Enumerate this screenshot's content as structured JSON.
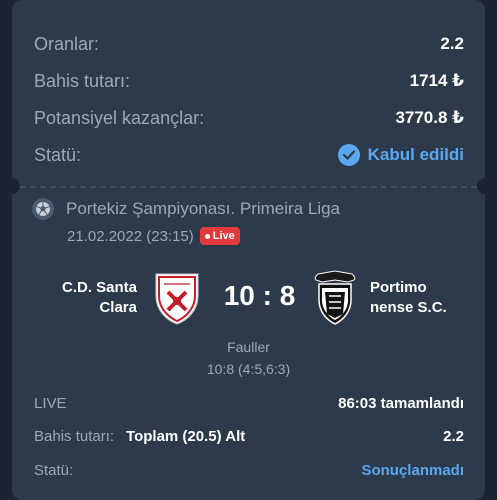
{
  "summary": {
    "odds_label": "Oranlar:",
    "odds_value": "2.2",
    "stake_label": "Bahis tutarı:",
    "stake_value": "1714 ₺",
    "potential_label": "Potansiyel kazançlar:",
    "potential_value": "3770.8 ₺",
    "status_label": "Statü:",
    "status_value": "Kabul edildi"
  },
  "match": {
    "league": "Portekiz Şampiyonası. Primeira Liga",
    "datetime": "21.02.2022 (23:15)",
    "live_badge": "Live",
    "home_team": "C.D. Santa Clara",
    "away_team": "Portimo nense S.C.",
    "score": "10 : 8",
    "fouls_label": "Fauller",
    "fouls_value": "10:8 (4:5,6:3)"
  },
  "bet": {
    "state_label": "LIVE",
    "state_value": "86:03 tamamlandı",
    "stake_label": "Bahis tutarı:",
    "selection": "Toplam (20.5) Alt",
    "odds": "2.2",
    "status_label": "Statü:",
    "status_value": "Sonuçlanmadı"
  },
  "colors": {
    "background": "#1a2533",
    "card": "#2c3a4c",
    "accent": "#5aa8f0",
    "live": "#e03a3a"
  },
  "icons": {
    "status": "check-circle-icon",
    "league": "football-icon",
    "home_crest": "santa-clara-crest-icon",
    "away_crest": "portimonense-crest-icon"
  }
}
